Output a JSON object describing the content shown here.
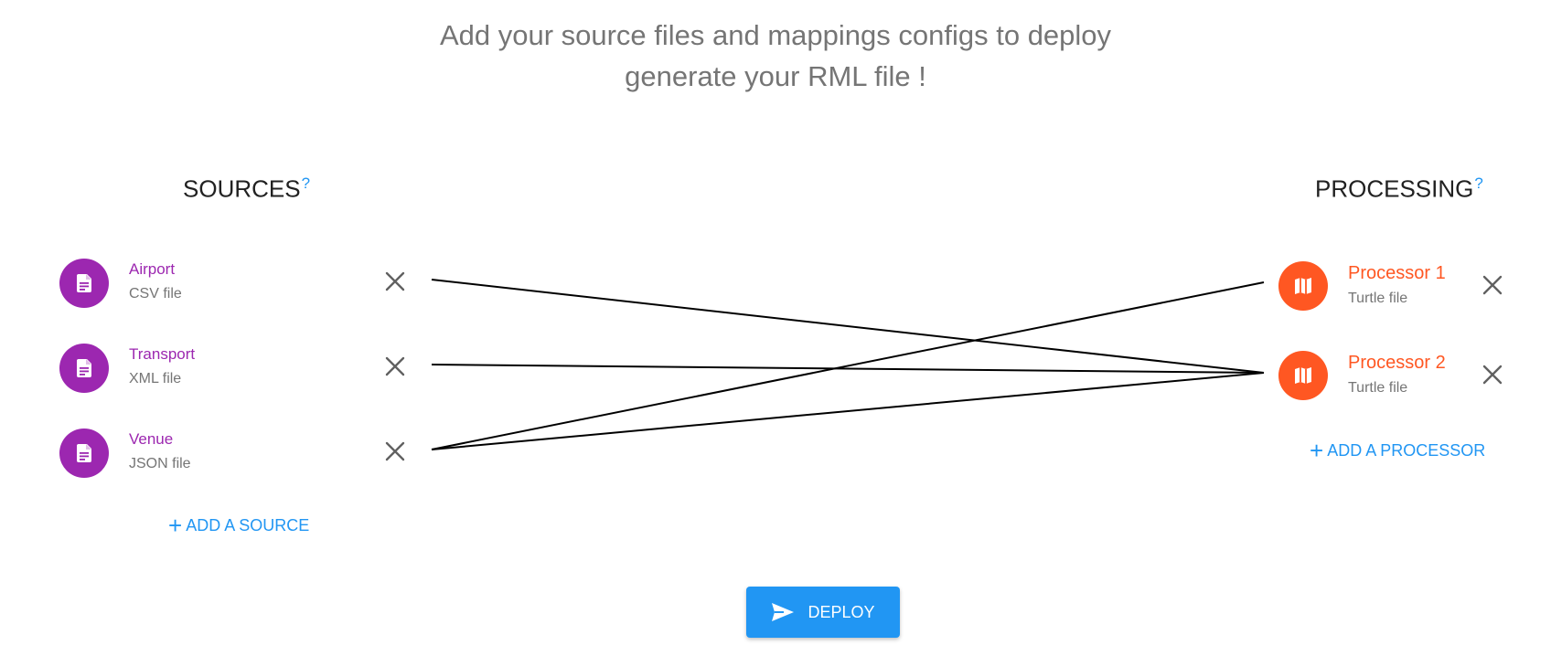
{
  "intro": {
    "line1": "Add your source files and mappings configs to deploy",
    "line2": "generate your RML file !"
  },
  "sources": {
    "title": "SOURCES",
    "help": "?",
    "add_label": "ADD A SOURCE",
    "items": [
      {
        "name": "Airport",
        "type": "CSV file",
        "icon": "file-document-icon"
      },
      {
        "name": "Transport",
        "type": "XML file",
        "icon": "file-document-icon"
      },
      {
        "name": "Venue",
        "type": "JSON file",
        "icon": "file-document-icon"
      }
    ]
  },
  "processing": {
    "title": "PROCESSING",
    "help": "?",
    "add_label": "ADD A PROCESSOR",
    "items": [
      {
        "name": "Processor 1",
        "type": "Turtle file",
        "icon": "map-icon"
      },
      {
        "name": "Processor 2",
        "type": "Turtle file",
        "icon": "map-icon"
      }
    ]
  },
  "links": [
    {
      "source": "Airport",
      "processor": "Processor 2"
    },
    {
      "source": "Transport",
      "processor": "Processor 2"
    },
    {
      "source": "Venue",
      "processor": "Processor 1"
    },
    {
      "source": "Venue",
      "processor": "Processor 2"
    }
  ],
  "deploy": {
    "label": "DEPLOY",
    "icon": "send-icon"
  },
  "colors": {
    "source": "#9c27b0",
    "processor": "#ff5722",
    "accent": "#2196f3",
    "link": "#000000"
  }
}
